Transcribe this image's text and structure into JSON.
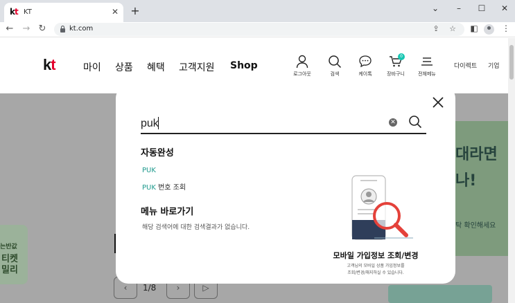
{
  "browser": {
    "tab_title": "KT",
    "tab_favicon": "kt",
    "new_tab_icon": "+",
    "url": "kt.com"
  },
  "header": {
    "logo": "kt",
    "nav": [
      "마이",
      "상품",
      "혜택",
      "고객지원",
      "Shop"
    ],
    "utilities": [
      {
        "label": "로그아웃",
        "icon": "person-icon"
      },
      {
        "label": "검색",
        "icon": "search-icon"
      },
      {
        "label": "케이톡",
        "icon": "chat-icon"
      },
      {
        "label": "장바구니",
        "icon": "cart-icon",
        "badge": "0"
      },
      {
        "label": "전체메뉴",
        "icon": "menu-icon"
      }
    ],
    "extra_links": [
      "다이렉트",
      "기업"
    ]
  },
  "search": {
    "query": "puk",
    "autocomplete_title": "자동완성",
    "suggestions": [
      {
        "highlight": "PUK",
        "rest": ""
      },
      {
        "highlight": "PUK",
        "rest": " 번호 조회"
      }
    ],
    "menu_title": "메뉴 바로가기",
    "no_result_text": "해당 검색어에 대한 검색결과가 없습니다."
  },
  "promo": {
    "title": "모바일 가입정보 조회/변경",
    "desc_line1": "고객님의 모바일 상품 가입정보를",
    "desc_line2": "조회/변경/해지하실 수 있습니다."
  },
  "background": {
    "right_text1": "대라면",
    "right_text2": "나!",
    "right_small": "탁 확인해세요",
    "left_text1": "는반값",
    "left_text2": "티켓\n밀리",
    "pager_count": "1/8"
  },
  "colors": {
    "brand_red": "#e4002b",
    "accent_teal": "#1f9a8d",
    "dim_overlay": "#a7a7a7"
  }
}
